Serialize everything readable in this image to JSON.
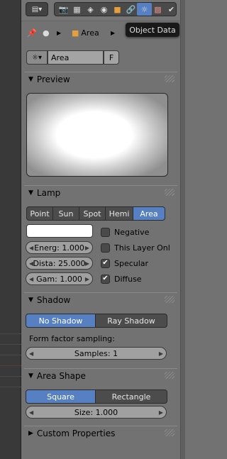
{
  "header": {
    "menu_icon": "editor-type-icon",
    "tabs": [
      "render-icon",
      "render-layers-icon",
      "scene-icon",
      "world-icon",
      "object-icon",
      "constraints-icon",
      "object-data-icon",
      "texture-icon",
      "material-icon"
    ],
    "active_tab": "object-data-icon",
    "tooltip": "Object Data"
  },
  "breadcrumb": {
    "item": "Area"
  },
  "context": {
    "name": "Area",
    "fake_user": "F"
  },
  "sections": {
    "preview": "Preview",
    "lamp": "Lamp",
    "shadow": "Shadow",
    "area_shape": "Area Shape",
    "custom_props": "Custom Properties"
  },
  "lamp": {
    "types": [
      "Point",
      "Sun",
      "Spot",
      "Hemi",
      "Area"
    ],
    "active_type": "Area",
    "color": "#ffffff",
    "energy": "Energ: 1.000",
    "distance": "Dista: 25.000",
    "gamma": "Gam: 1.000",
    "negative": "Negative",
    "negative_checked": false,
    "this_layer": "This Layer Onl",
    "this_layer_checked": false,
    "specular": "Specular",
    "specular_checked": true,
    "diffuse": "Diffuse",
    "diffuse_checked": true
  },
  "shadow": {
    "options": [
      "No Shadow",
      "Ray Shadow"
    ],
    "active": "No Shadow",
    "form_factor_label": "Form factor sampling:",
    "samples": "Samples: 1"
  },
  "area_shape": {
    "options": [
      "Square",
      "Rectangle"
    ],
    "active": "Square",
    "size": "Size: 1.000"
  },
  "colors": {
    "accent": "#5680c2",
    "panel": "#727272",
    "viewport": "#393939"
  }
}
